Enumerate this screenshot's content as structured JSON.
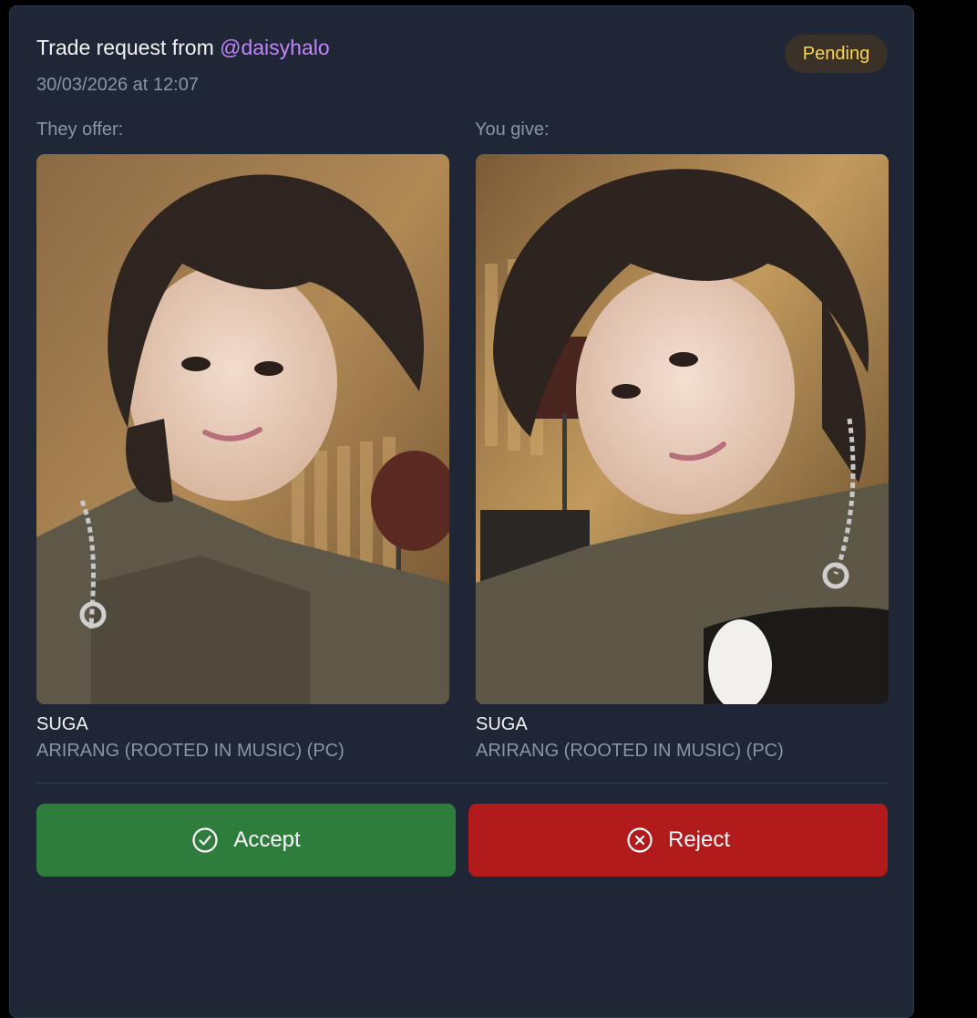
{
  "request": {
    "title_prefix": "Trade request from ",
    "username": "@daisyhalo",
    "timestamp": "30/03/2026 at 12:07",
    "status": "Pending"
  },
  "offer": {
    "label": "They offer:",
    "member": "SUGA",
    "album": "ARIRANG (ROOTED IN MUSIC) (PC)"
  },
  "give": {
    "label": "You give:",
    "member": "SUGA",
    "album": "ARIRANG (ROOTED IN MUSIC) (PC)"
  },
  "actions": {
    "accept_label": "Accept",
    "reject_label": "Reject",
    "accept_icon": "check-circle-icon",
    "reject_icon": "x-circle-icon"
  },
  "colors": {
    "card_bg": "#1f2736",
    "username": "#c084fc",
    "pending_text": "#fcd34d",
    "accept": "#2f7d3c",
    "reject": "#b21b1b"
  }
}
